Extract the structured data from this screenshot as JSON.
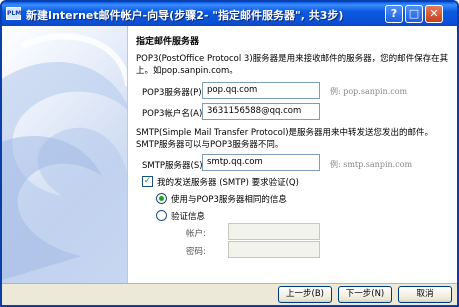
{
  "window": {
    "title": "新建Internet邮件帐户-向导(步骤2- \"指定邮件服务器\", 共3步)",
    "app_icon_text": "PLM"
  },
  "section_title": "指定邮件服务器",
  "pop3_description": "POP3(PostOffice Protocol 3)服务器是用来接收邮件的服务器，您的邮件保存在其上。如pop.sanpin.com。",
  "pop3_server": {
    "label": "POP3服务器(P):",
    "value": "pop.qq.com",
    "example": "例: pop.sanpin.com"
  },
  "pop3_account": {
    "label": "POP3帐户名(A):",
    "value": "3631156588@qq.com"
  },
  "smtp_description": "SMTP(Simple Mail Transfer Protocol)是服务器用来中转发送您发出的邮件。SMTP服务器可以与POP3服务器不同。",
  "smtp_server": {
    "label": "SMTP服务器(S):",
    "value": "smtp.qq.com",
    "example": "例: smtp.sanpin.com"
  },
  "smtp_auth": {
    "checkbox_label": "我的发送服务器 (SMTP) 要求验证(Q)",
    "checked": true,
    "option_same": "使用与POP3服务器相同的信息",
    "option_custom": "验证信息",
    "account_label": "帐户:",
    "password_label": "密码:",
    "account_value": "",
    "password_value": ""
  },
  "buttons": {
    "back": "上一步(B)",
    "next": "下一步(N)",
    "cancel": "取消"
  },
  "colors": {
    "titlebar": "#0b4fd6",
    "accent_green": "#21a121",
    "face": "#ece9d8"
  },
  "icons": {
    "close": "close-icon",
    "maximize": "maximize-icon",
    "help": "help-icon"
  }
}
